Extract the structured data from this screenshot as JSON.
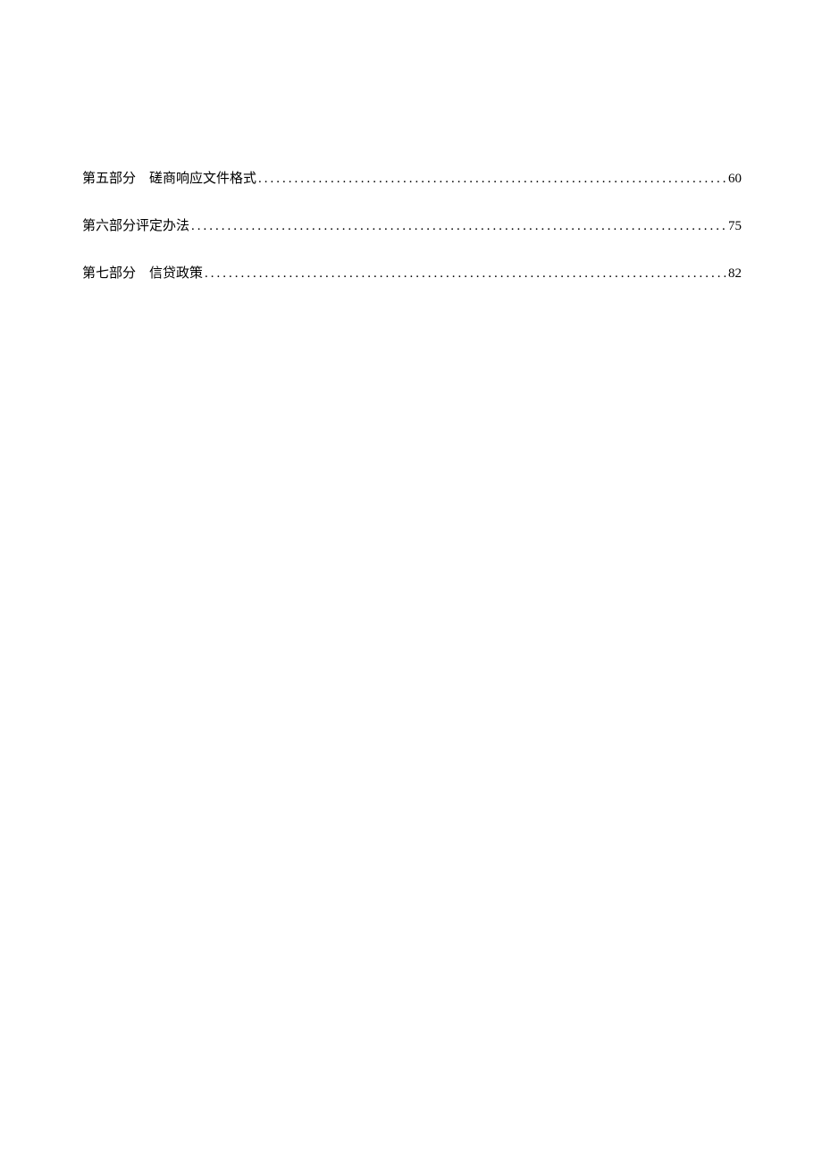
{
  "toc": {
    "entries": [
      {
        "label": "第五部分　磋商响应文件格式",
        "page": "60"
      },
      {
        "label": "第六部分评定办法",
        "page": "75"
      },
      {
        "label": "第七部分　信贷政策",
        "page": "82"
      }
    ]
  }
}
